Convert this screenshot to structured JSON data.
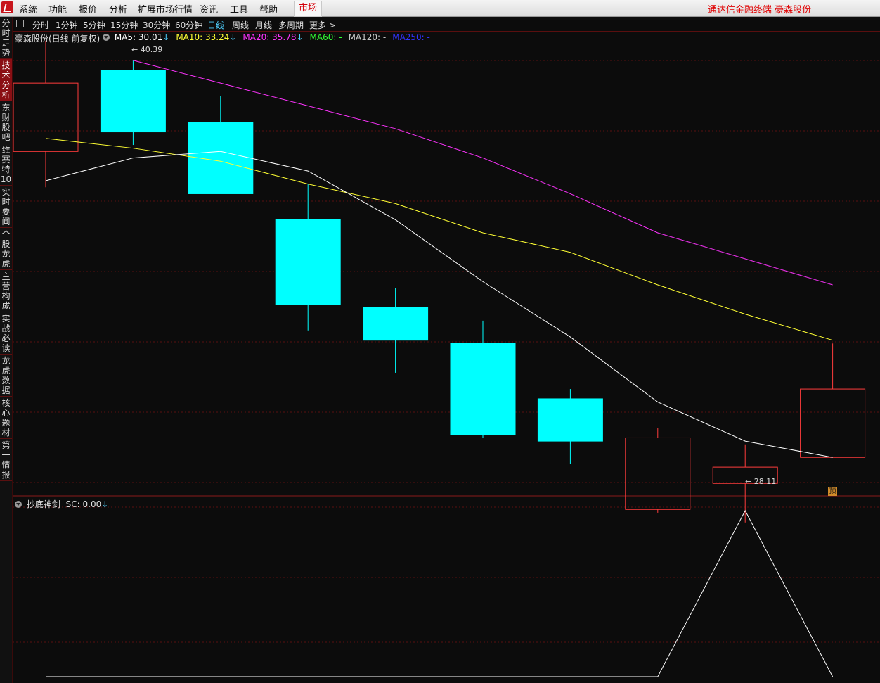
{
  "menubar": {
    "items": [
      "系统",
      "功能",
      "报价",
      "分析",
      "扩展市场行情",
      "资讯",
      "工具",
      "帮助"
    ],
    "market_button": "市场",
    "right_title": "通达信金融终端 豪森股份"
  },
  "side_tabs": [
    "分时走势",
    "技术分析",
    "东财股吧",
    "维赛特10",
    "实时要闻",
    "个股龙虎",
    "主营构成",
    "实战必读",
    "龙虎数据",
    "核心题材",
    "第一情报"
  ],
  "active_side_tab": "技术分析",
  "period_bar": {
    "periods": [
      "分时",
      "1分钟",
      "5分钟",
      "15分钟",
      "30分钟",
      "60分钟",
      "日线",
      "周线",
      "月线",
      "多周期",
      "更多 >"
    ],
    "active": "日线"
  },
  "main_legend": {
    "title": "豪森股份(日线 前复权)",
    "ma": [
      {
        "label": "MA5: 30.01",
        "arrow": "↓",
        "color": "#ffffff"
      },
      {
        "label": "MA10: 33.24",
        "arrow": "↓",
        "color": "#ffff33"
      },
      {
        "label": "MA20: 35.78",
        "arrow": "↓",
        "color": "#ff33ff"
      },
      {
        "label": "MA60: -",
        "arrow": "",
        "color": "#33ff33"
      },
      {
        "label": "MA120: -",
        "arrow": "",
        "color": "#c8c8c8"
      },
      {
        "label": "MA250: -",
        "arrow": "",
        "color": "#3333ff"
      }
    ],
    "arrow_color": "#4fd0ff"
  },
  "annotations": {
    "high": "40.39",
    "low": "28.11",
    "pre_badge": "预"
  },
  "sub_legend": {
    "title": "抄底神剑",
    "sc": "SC: 0.00",
    "arrow": "↓"
  },
  "colors": {
    "up": "#ff3c3c",
    "down": "#00ffff",
    "grid": "#5a1010",
    "ma5": "#ffffff",
    "ma10": "#ffff33",
    "ma20": "#ff33ff",
    "sc": "#ffffff"
  },
  "chart_data": {
    "type": "candlestick",
    "ylim": [
      27.6,
      41.0
    ],
    "candles": [
      {
        "open": 37.6,
        "close": 39.7,
        "high": 41.0,
        "low": 36.5,
        "up": true
      },
      {
        "open": 40.1,
        "close": 38.2,
        "high": 40.39,
        "low": 37.8,
        "up": false
      },
      {
        "open": 38.5,
        "close": 36.3,
        "high": 39.3,
        "low": 36.3,
        "up": false
      },
      {
        "open": 35.5,
        "close": 32.9,
        "high": 36.6,
        "low": 32.1,
        "up": false
      },
      {
        "open": 32.8,
        "close": 31.8,
        "high": 33.4,
        "low": 30.8,
        "up": false
      },
      {
        "open": 31.7,
        "close": 28.9,
        "high": 32.4,
        "low": 28.8,
        "up": false
      },
      {
        "open": 30.0,
        "close": 28.7,
        "high": 30.3,
        "low": 28.0,
        "up": false
      },
      {
        "open": 28.8,
        "close": 26.6,
        "high": 29.1,
        "low": 26.5,
        "up": true
      },
      {
        "open": 27.4,
        "close": 27.9,
        "high": 28.6,
        "low": 26.2,
        "up": true
      },
      {
        "open": 28.2,
        "close": 30.3,
        "high": 31.7,
        "low": 28.2,
        "up": true
      }
    ],
    "ma5": [
      36.7,
      37.4,
      37.6,
      37.0,
      35.5,
      33.6,
      31.9,
      29.9,
      28.7,
      28.2
    ],
    "ma10": [
      38.0,
      37.7,
      37.3,
      36.6,
      36.0,
      35.1,
      34.5,
      33.5,
      32.6,
      31.8
    ],
    "ma20": [
      null,
      40.4,
      39.7,
      39.0,
      38.3,
      37.4,
      36.3,
      35.1,
      34.3,
      33.5
    ],
    "sc": [
      0,
      0,
      0,
      0,
      0,
      0,
      0,
      0,
      1,
      0
    ]
  }
}
